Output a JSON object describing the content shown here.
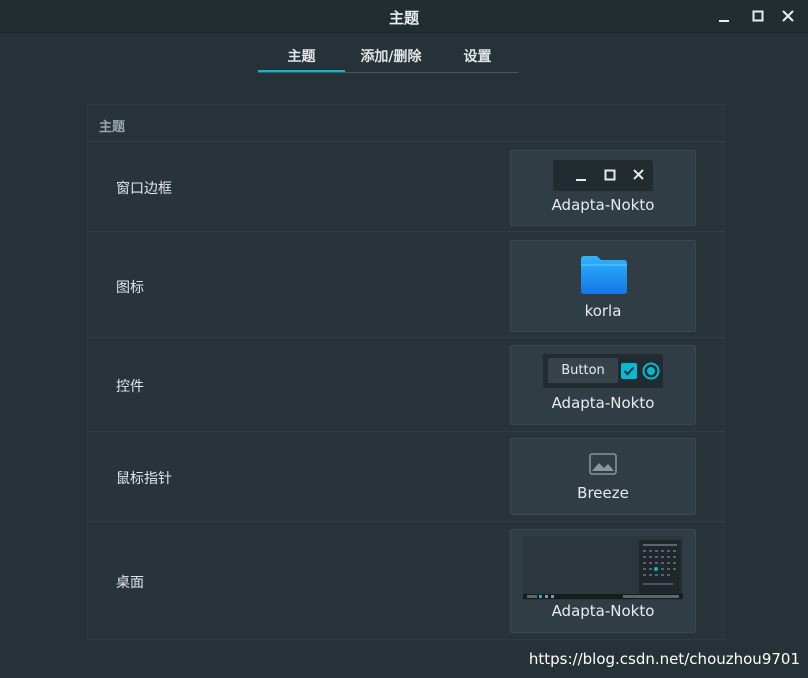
{
  "window": {
    "title": "主题"
  },
  "tabs": [
    {
      "label": "主题",
      "active": true
    },
    {
      "label": "添加/删除",
      "active": false
    },
    {
      "label": "设置",
      "active": false
    }
  ],
  "section": {
    "title": "主题",
    "rows": [
      {
        "label": "窗口边框",
        "theme": "Adapta-Nokto"
      },
      {
        "label": "图标",
        "theme": "korla"
      },
      {
        "label": "控件",
        "theme": "Adapta-Nokto",
        "button_label": "Button"
      },
      {
        "label": "鼠标指针",
        "theme": "Breeze"
      },
      {
        "label": "桌面",
        "theme": "Adapta-Nokto"
      }
    ]
  },
  "watermark": "https://blog.csdn.net/chouzhou9701",
  "colors": {
    "accent": "#00bcd4",
    "background": "#263238",
    "panel": "#28333a",
    "card": "#313d44",
    "folder": "#1e9bf0"
  }
}
